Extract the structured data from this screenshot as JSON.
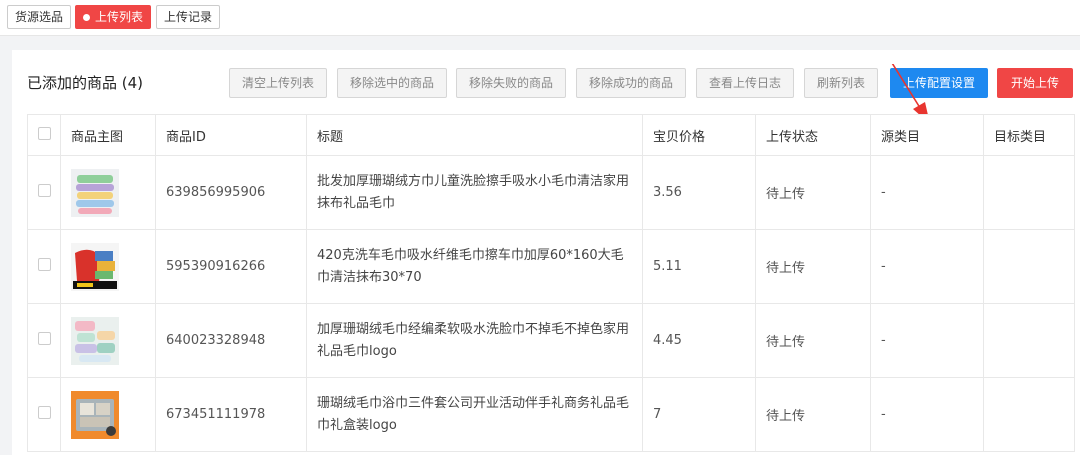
{
  "top_tabs": [
    {
      "label": "货源选品",
      "active": false
    },
    {
      "label": "上传列表",
      "active": true
    },
    {
      "label": "上传记录",
      "active": false
    }
  ],
  "section": {
    "title": "已添加的商品 (4)"
  },
  "toolbar": {
    "clear_list": "清空上传列表",
    "remove_selected": "移除选中的商品",
    "remove_failed": "移除失败的商品",
    "remove_success": "移除成功的商品",
    "view_log": "查看上传日志",
    "refresh": "刷新列表",
    "upload_settings": "上传配置设置",
    "start_upload": "开始上传"
  },
  "table": {
    "headers": [
      "商品主图",
      "商品ID",
      "标题",
      "宝贝价格",
      "上传状态",
      "源类目",
      "目标类目"
    ],
    "rows": [
      {
        "id": "639856995906",
        "title": "批发加厚珊瑚绒方巾儿童洗脸擦手吸水小毛巾清洁家用抹布礼品毛巾",
        "price": "3.56",
        "status": "待上传",
        "source_category": "-",
        "target_category": ""
      },
      {
        "id": "595390916266",
        "title": "420克洗车毛巾吸水纤维毛巾擦车巾加厚60*160大毛巾清洁抹布30*70",
        "price": "5.11",
        "status": "待上传",
        "source_category": "-",
        "target_category": ""
      },
      {
        "id": "640023328948",
        "title": "加厚珊瑚绒毛巾经编柔软吸水洗脸巾不掉毛不掉色家用礼品毛巾logo",
        "price": "4.45",
        "status": "待上传",
        "source_category": "-",
        "target_category": ""
      },
      {
        "id": "673451111978",
        "title": "珊瑚绒毛巾浴巾三件套公司开业活动伴手礼商务礼品毛巾礼盒装logo",
        "price": "7",
        "status": "待上传",
        "source_category": "-",
        "target_category": ""
      }
    ]
  },
  "colors": {
    "accent_red": "#f04645",
    "primary_blue": "#1e89f0"
  }
}
